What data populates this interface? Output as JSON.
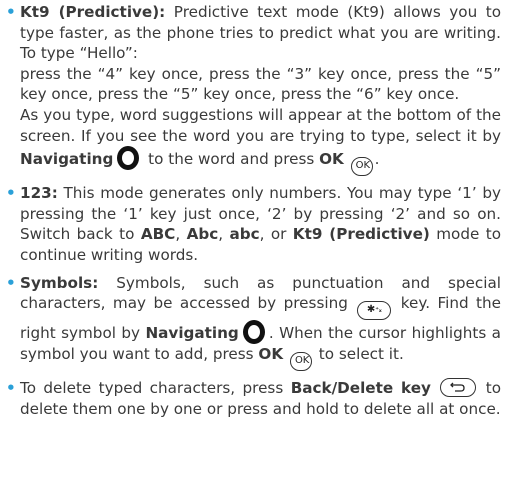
{
  "items": [
    {
      "term": "Kt9 (Predictive):",
      "text1": " Predictive text mode (Kt9) allows you to type faster, as the phone tries to predict what you are writing. To type “Hello”:",
      "text2": "press the “4” key once, press the “3” key once, press the “5” key once, press the “5” key once, press the “6” key once.",
      "text3a": "As you type, word suggestions will appear at the bottom of the screen. If you see the word you are trying to type, select it by ",
      "nav": "Navigating",
      "text3b": " to the word and press ",
      "ok": "OK",
      "text3c": "."
    },
    {
      "term": "123:",
      "text1": " This mode generates only numbers. You may type ‘1’ by pressing the ‘1’ key just once, ‘2’ by pressing ‘2’ and so on. Switch back to ",
      "abc1": "ABC",
      "sep1": ", ",
      "abc2": "Abc",
      "sep2": ", ",
      "abc3": "abc",
      "sep3": ", or ",
      "kt9": "Kt9 (Predictive)",
      "text2": " mode to continue writing words."
    },
    {
      "term": "Symbols:",
      "text1": " Symbols, such as punctuation and special characters, may be accessed by pressing ",
      "text2": " key. Find the right symbol by ",
      "nav": "Navigating",
      "text3": ". When the cursor highlights a symbol you want to add, press ",
      "ok": "OK",
      "text4": " to select it."
    },
    {
      "text1": "To delete typed characters, press ",
      "back": "Back/Delete key",
      "text2": " to delete them one by one or press and hold to delete all at once."
    }
  ],
  "icons": {
    "ok_key_label": "OK",
    "star_key_label": "✱",
    "star_key_sup": "⁺ₓ"
  },
  "colors": {
    "bullet": "#2aa0d8",
    "text": "#3a3a3a"
  }
}
